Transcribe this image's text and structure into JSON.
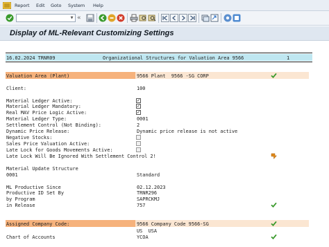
{
  "menu": {
    "items": [
      "Report",
      "Edit",
      "Goto",
      "System",
      "Help"
    ]
  },
  "toolbar": {
    "command_value": "",
    "icons": [
      "enter-icon",
      "save-icon",
      "back-icon",
      "exit-icon",
      "cancel-icon",
      "print-icon",
      "find-icon",
      "find-next-icon",
      "first-page-icon",
      "previous-page-icon",
      "next-page-icon",
      "last-page-icon",
      "create-session-icon",
      "shortcut-icon",
      "settings-icon",
      "help-icon"
    ]
  },
  "title": "Display of ML-Relevant Customizing Settings",
  "header_line": {
    "date_user": "16.02.2024 TRNR09",
    "subject": "Organizational Structures for Valuation Area 9566",
    "page": "1"
  },
  "valuation_area": {
    "label": "Valuation Area (Plant)",
    "value": "9566 Plant  9566 -SG CORP"
  },
  "client": {
    "label": "Client:",
    "value": "100"
  },
  "settings": [
    {
      "label": "Material Ledger Active:",
      "checkbox": true
    },
    {
      "label": "Material Ledger Mandatory:",
      "checkbox": true
    },
    {
      "label": "Real MAV Price Logic Active:",
      "checkbox": true
    },
    {
      "label": "Material Ledger Type:",
      "value": "0001"
    },
    {
      "label": "Settlement Control (Not Binding):",
      "value": "2"
    },
    {
      "label": "Dynamic Price Release:",
      "value": "Dynamic price release is not active"
    },
    {
      "label": "Negative Stocks:",
      "checkbox": false
    },
    {
      "label": "Sales Price Valuation Active:",
      "checkbox": false
    },
    {
      "label": "Late Lock for Goods Movements Active:",
      "checkbox": false
    },
    {
      "label": "Late Lock Will Be Ignored With Settlement Control 2!",
      "value": ""
    }
  ],
  "update_structure": {
    "heading": "Material Update Structure",
    "code": "0001",
    "value": "Standard"
  },
  "productive": [
    {
      "label": "ML Productive Since",
      "value": "02.12.2023"
    },
    {
      "label": "Productive ID Set By",
      "value": "TRNR296"
    },
    {
      "label": "by Program",
      "value": "SAPRCKMJ"
    },
    {
      "label": "in Release",
      "value": "757"
    }
  ],
  "company_code": {
    "label": "Assigned Company Code:",
    "value": "9566 Company Code 9566-SG",
    "country": "US  USA"
  },
  "chart_of_accounts": {
    "label": "Chart of Accounts",
    "value": "YCOA"
  },
  "colors": {
    "highlight_orange": "#f6b27c",
    "highlight_peach": "#fbe6d2",
    "header_cyan": "#bfe7f1",
    "check_green": "#3a9a2c",
    "warning_orange": "#e08a1a"
  }
}
